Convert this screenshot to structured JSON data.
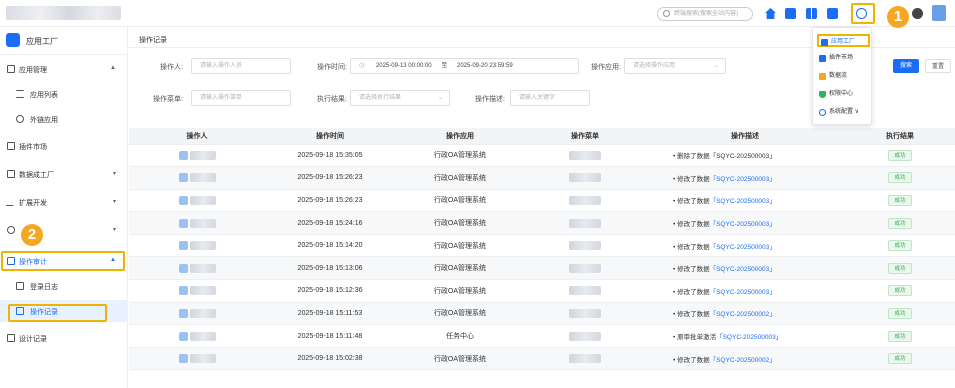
{
  "topbar": {
    "search_placeholder": "跨端搜索(搜索全站内容)",
    "callout1": "1",
    "callout2": "2"
  },
  "sidebar": {
    "app_title": "应用工厂",
    "items": [
      {
        "label": "应用管理",
        "icon": "grid-icon",
        "arrow": "▲"
      },
      {
        "label": "应用列表",
        "icon": "list-icon",
        "sub": true
      },
      {
        "label": "外链应用",
        "icon": "link-icon",
        "sub": true
      },
      {
        "label": "插件市场",
        "icon": "puzzle-icon"
      },
      {
        "label": "数据成工厂",
        "icon": "database-icon",
        "arrow": "▾"
      },
      {
        "label": "扩展开发",
        "icon": "extension-icon",
        "arrow": "▾"
      },
      {
        "label": "",
        "icon": "gear-icon",
        "arrow": "▾"
      },
      {
        "label": "操作审计",
        "icon": "audit-icon",
        "arrow": "▲"
      },
      {
        "label": "登录日志",
        "icon": "login-log-icon",
        "sub": true
      },
      {
        "label": "操作记录",
        "icon": "operation-log-icon",
        "sub": true
      },
      {
        "label": "设计记录",
        "icon": "design-log-icon"
      }
    ]
  },
  "page": {
    "breadcrumb": "操作记录"
  },
  "filters": {
    "operator_label": "操作人:",
    "operator_placeholder": "请输入操作人员",
    "time_label": "操作时间:",
    "time_start": "2025-09-13 00:00:00",
    "time_sep": "至",
    "time_end": "2025-09-20 23:59:59",
    "app_label": "操作应用:",
    "app_placeholder": "请选择操作应用",
    "menu_label": "操作菜单:",
    "menu_placeholder": "请输入操作菜单",
    "result_label": "执行结果:",
    "result_placeholder": "请选择执行结果",
    "desc_label": "操作描述:",
    "desc_placeholder": "请输入关键字",
    "search_btn": "搜索",
    "reset_btn": "重置"
  },
  "table": {
    "columns": [
      "操作人",
      "操作时间",
      "操作应用",
      "操作菜单",
      "操作描述",
      "执行结果"
    ],
    "rows": [
      {
        "time": "2025-09-18 15:35:05",
        "app": "行政OA管理系统",
        "desc": "删除了数据「SQYC-202500003」",
        "link": false,
        "result": "成功"
      },
      {
        "time": "2025-09-18 15:26:23",
        "app": "行政OA管理系统",
        "desc_prefix": "修改了数据",
        "desc_link": "「SQYC-202500003」",
        "result": "成功"
      },
      {
        "time": "2025-09-18 15:26:23",
        "app": "行政OA管理系统",
        "desc_prefix": "修改了数据",
        "desc_link": "「SQYC-202500003」",
        "result": "成功"
      },
      {
        "time": "2025-09-18 15:24:16",
        "app": "行政OA管理系统",
        "desc_prefix": "修改了数据",
        "desc_link": "「SQYC-202500003」",
        "result": "成功"
      },
      {
        "time": "2025-09-18 15:14:20",
        "app": "行政OA管理系统",
        "desc_prefix": "修改了数据",
        "desc_link": "「SQYC-202500003」",
        "result": "成功"
      },
      {
        "time": "2025-09-18 15:13:06",
        "app": "行政OA管理系统",
        "desc_prefix": "修改了数据",
        "desc_link": "「SQYC-202500003」",
        "result": "成功"
      },
      {
        "time": "2025-09-18 15:12:36",
        "app": "行政OA管理系统",
        "desc_prefix": "修改了数据",
        "desc_link": "「SQYC-202500003」",
        "result": "成功"
      },
      {
        "time": "2025-09-18 15:11:53",
        "app": "行政OA管理系统",
        "desc_prefix": "修改了数据",
        "desc_link": "「SQYC-202500002」",
        "result": "成功"
      },
      {
        "time": "2025-09-18 15:11:48",
        "app": "任务中心",
        "desc_prefix": "原审批单激活",
        "desc_link": "「SQYC-202500003」",
        "result": "成功"
      },
      {
        "time": "2025-09-18 15:02:38",
        "app": "行政OA管理系统",
        "desc_prefix": "修改了数据",
        "desc_link": "「SQYC-202500002」",
        "result": "成功"
      }
    ]
  },
  "dropdown": {
    "items": [
      {
        "label": "应用工厂",
        "color": "#1b6ef3"
      },
      {
        "label": "插件市场",
        "color": "#1b6ef3"
      },
      {
        "label": "数据流",
        "color": "#f5a623"
      },
      {
        "label": "权限中心",
        "color": "#2db55d"
      },
      {
        "label": "系统配置 ∨",
        "color": "#1b6ef3"
      }
    ]
  },
  "colors": {
    "accent": "#1b6ef3",
    "highlight": "#f0b400",
    "success": "#3aa856"
  }
}
